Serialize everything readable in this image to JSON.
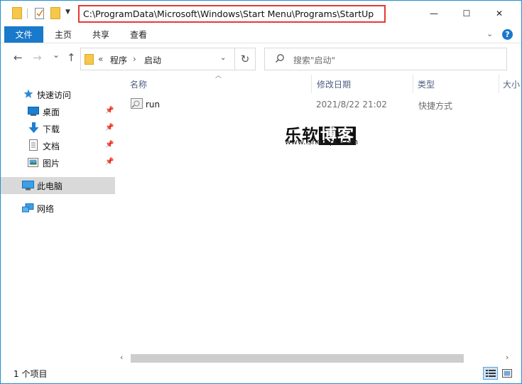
{
  "titlebar": {
    "path": "C:\\ProgramData\\Microsoft\\Windows\\Start Menu\\Programs\\StartUp",
    "minimize": "—",
    "maximize": "☐",
    "close": "✕"
  },
  "ribbon": {
    "tabs": [
      "文件",
      "主页",
      "共享",
      "查看"
    ]
  },
  "nav": {
    "back": "←",
    "forward": "→",
    "recent": "⌄",
    "up": "↑",
    "breadcrumb_prefix": "«",
    "breadcrumb": [
      "程序",
      "启动"
    ],
    "breadcrumb_sep": "›",
    "search_placeholder": "搜索\"启动\""
  },
  "sidebar": {
    "quick_access": "快速访问",
    "items": [
      {
        "label": "桌面",
        "icon": "desktop-icon"
      },
      {
        "label": "下载",
        "icon": "download-icon"
      },
      {
        "label": "文档",
        "icon": "document-icon"
      },
      {
        "label": "图片",
        "icon": "picture-icon"
      }
    ],
    "this_pc": "此电脑",
    "network": "网络"
  },
  "columns": [
    "名称",
    "修改日期",
    "类型",
    "大小"
  ],
  "files": [
    {
      "name": "run",
      "modified": "2021/8/22 21:02",
      "type": "快捷方式"
    }
  ],
  "watermark": {
    "part1": "乐软",
    "part2": "博客",
    "url": "www.isharepc.com"
  },
  "status": {
    "count": "1 个项目"
  },
  "colors": {
    "accent": "#1979ca",
    "highlight_border": "#e53935",
    "folder": "#f6c74a",
    "selected": "#d9d9d9"
  }
}
